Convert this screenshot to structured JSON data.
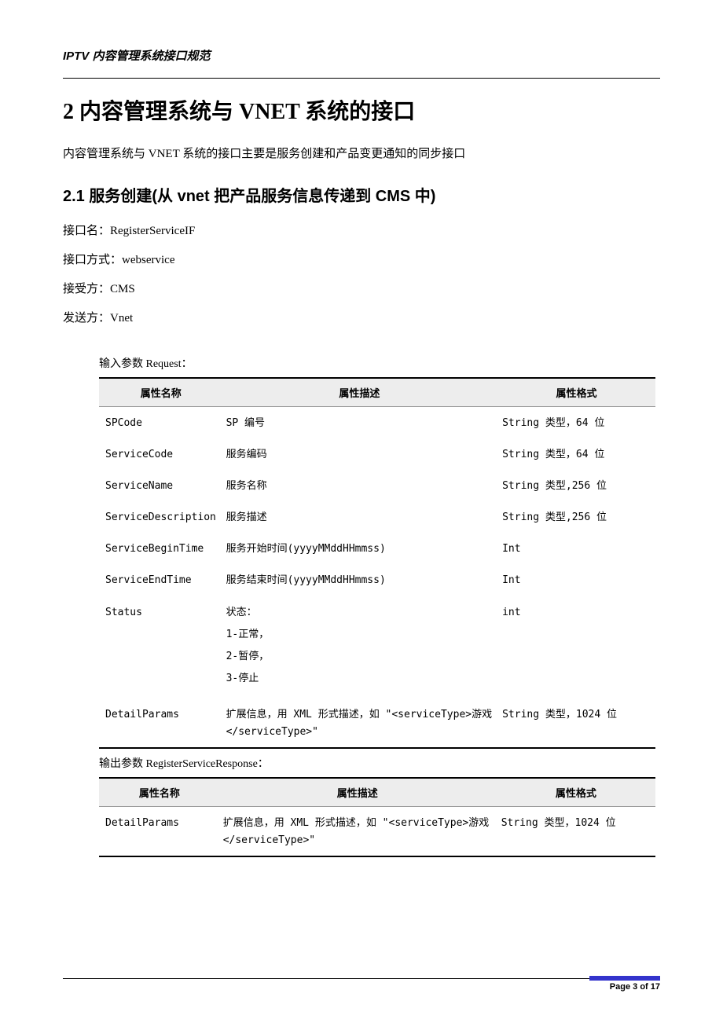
{
  "header": {
    "doc_title": "IPTV 内容管理系统接口规范"
  },
  "section": {
    "heading": "2 内容管理系统与 VNET 系统的接口",
    "intro": "内容管理系统与 VNET 系统的接口主要是服务创建和产品变更通知的同步接口",
    "sub_heading": "2.1 服务创建(从 vnet 把产品服务信息传递到 CMS 中)",
    "fields": {
      "iface_name_label": "接口名：",
      "iface_name_value": "RegisterServiceIF",
      "iface_mode_label": "接口方式：",
      "iface_mode_value": "webservice",
      "receiver_label": "接受方：",
      "receiver_value": "CMS",
      "sender_label": "发送方：",
      "sender_value": "Vnet"
    }
  },
  "request_table": {
    "label": "输入参数 Request：",
    "headers": {
      "name": "属性名称",
      "desc": "属性描述",
      "format": "属性格式"
    },
    "rows": [
      {
        "name": "SPCode",
        "desc": "SP 编号",
        "format": "String 类型，64 位"
      },
      {
        "name": "ServiceCode",
        "desc": "服务编码",
        "format": "String 类型，64 位"
      },
      {
        "name": "ServiceName",
        "desc": "服务名称",
        "format": "String 类型,256 位"
      },
      {
        "name": "ServiceDescription",
        "desc": "服务描述",
        "format": "String 类型,256 位"
      },
      {
        "name": "ServiceBeginTime",
        "desc": "服务开始时间(yyyyMMddHHmmss)",
        "format": "Int"
      },
      {
        "name": "ServiceEndTime",
        "desc": "服务结束时间(yyyyMMddHHmmss)",
        "format": "Int"
      },
      {
        "name": "Status",
        "desc_lines": [
          "状态：",
          "1-正常，",
          "2-暂停，",
          "3-停止"
        ],
        "format": "int"
      },
      {
        "name": "DetailParams",
        "desc": "扩展信息，用 XML 形式描述，如 \"<serviceType>游戏</serviceType>\"",
        "format": "String 类型，1024 位"
      }
    ]
  },
  "response_table": {
    "label": "输出参数 RegisterServiceResponse：",
    "headers": {
      "name": "属性名称",
      "desc": "属性描述",
      "format": "属性格式"
    },
    "rows": [
      {
        "name": "DetailParams",
        "desc": "扩展信息，用 XML 形式描述，如 \"<serviceType>游戏</serviceType>\"",
        "format": "String 类型，1024 位"
      }
    ]
  },
  "footer": {
    "page": "Page 3 of 17"
  }
}
